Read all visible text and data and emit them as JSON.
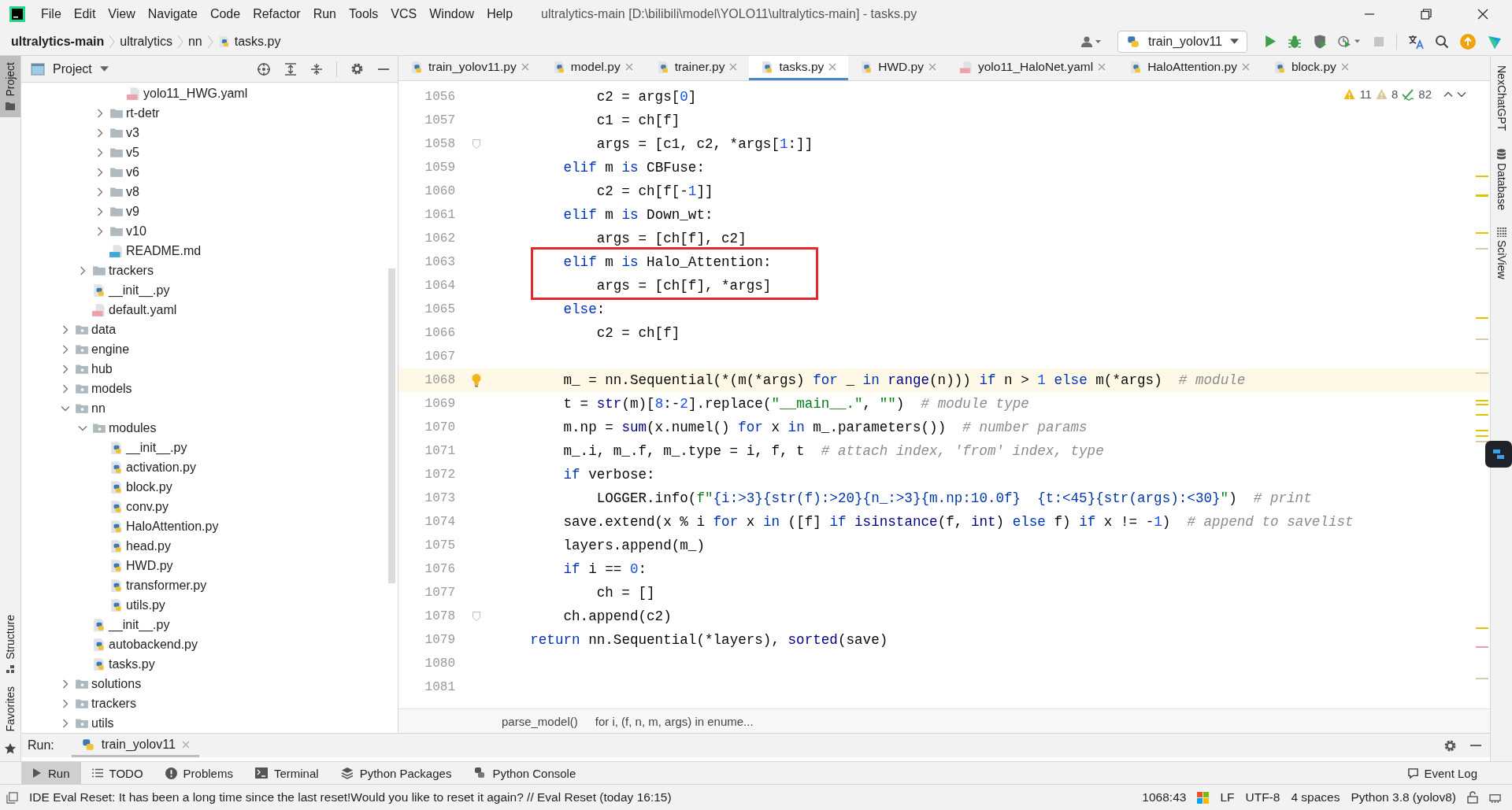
{
  "window": {
    "title": "ultralytics-main [D:\\bilibili\\model\\YOLO11\\ultralytics-main] - tasks.py",
    "menu": [
      "File",
      "Edit",
      "View",
      "Navigate",
      "Code",
      "Refactor",
      "Run",
      "Tools",
      "VCS",
      "Window",
      "Help"
    ]
  },
  "navbar": {
    "crumbs": [
      {
        "label": "ultralytics-main",
        "kind": "project"
      },
      {
        "label": "ultralytics",
        "kind": "folder"
      },
      {
        "label": "nn",
        "kind": "folder"
      },
      {
        "label": "tasks.py",
        "kind": "py"
      }
    ]
  },
  "toolbar": {
    "run_config": "train_yolov11"
  },
  "left_strip": [
    {
      "label": "Project",
      "kind": "project",
      "selected": true
    },
    {
      "label": "Structure",
      "kind": "structure",
      "selected": false
    },
    {
      "label": "Favorites",
      "kind": "favorites",
      "selected": false
    }
  ],
  "project": {
    "title": "Project",
    "tree": [
      {
        "children": [
          {
            "children": [
              {
                "children": [
                  {
                    "label": "yolo11_HWG.yaml",
                    "kind": "yaml"
                  }
                ]
              },
              {
                "label": "rt-detr",
                "kind": "folder",
                "expanded": false
              },
              {
                "label": "v3",
                "kind": "folder",
                "expanded": false
              },
              {
                "label": "v5",
                "kind": "folder",
                "expanded": false
              },
              {
                "label": "v6",
                "kind": "folder",
                "expanded": false
              },
              {
                "label": "v8",
                "kind": "folder",
                "expanded": false
              },
              {
                "label": "v9",
                "kind": "folder",
                "expanded": false
              },
              {
                "label": "v10",
                "kind": "folder",
                "expanded": false
              },
              {
                "label": "README.md",
                "kind": "md"
              }
            ]
          },
          {
            "label": "trackers",
            "kind": "folder",
            "expanded": false
          },
          {
            "label": "__init__.py",
            "kind": "py"
          },
          {
            "label": "default.yaml",
            "kind": "yaml"
          }
        ]
      },
      {
        "label": "data",
        "kind": "package",
        "expanded": false
      },
      {
        "label": "engine",
        "kind": "package",
        "expanded": false
      },
      {
        "label": "hub",
        "kind": "package",
        "expanded": false
      },
      {
        "label": "models",
        "kind": "package",
        "expanded": false
      },
      {
        "label": "nn",
        "kind": "package",
        "expanded": true,
        "children": [
          {
            "label": "modules",
            "kind": "package",
            "expanded": true,
            "children": [
              {
                "label": "__init__.py",
                "kind": "py"
              },
              {
                "label": "activation.py",
                "kind": "py"
              },
              {
                "label": "block.py",
                "kind": "py"
              },
              {
                "label": "conv.py",
                "kind": "py"
              },
              {
                "label": "HaloAttention.py",
                "kind": "py"
              },
              {
                "label": "head.py",
                "kind": "py"
              },
              {
                "label": "HWD.py",
                "kind": "py"
              },
              {
                "label": "transformer.py",
                "kind": "py"
              },
              {
                "label": "utils.py",
                "kind": "py"
              }
            ]
          },
          {
            "label": "__init__.py",
            "kind": "py"
          },
          {
            "label": "autobackend.py",
            "kind": "py"
          },
          {
            "label": "tasks.py",
            "kind": "py"
          }
        ]
      },
      {
        "label": "solutions",
        "kind": "package",
        "expanded": false
      },
      {
        "label": "trackers",
        "kind": "package",
        "expanded": false
      },
      {
        "label": "utils",
        "kind": "package",
        "expanded": false
      }
    ]
  },
  "tabs": [
    {
      "label": "train_yolov11.py",
      "kind": "py",
      "selected": false
    },
    {
      "label": "model.py",
      "kind": "py",
      "selected": false
    },
    {
      "label": "trainer.py",
      "kind": "py",
      "selected": false
    },
    {
      "label": "tasks.py",
      "kind": "py",
      "selected": true
    },
    {
      "label": "HWD.py",
      "kind": "py",
      "selected": false
    },
    {
      "label": "yolo11_HaloNet.yaml",
      "kind": "yaml",
      "selected": false
    },
    {
      "label": "HaloAttention.py",
      "kind": "py",
      "selected": false
    },
    {
      "label": "block.py",
      "kind": "py",
      "selected": false
    }
  ],
  "inspections": {
    "warnings": "11",
    "weak_warnings": "8",
    "typos": "82"
  },
  "code": {
    "lines": [
      {
        "number": "1056",
        "current": false,
        "boxed": false,
        "segments": [
          {
            "text": "            c2 = args[",
            "kind": "p"
          },
          {
            "text": "0",
            "kind": "num"
          },
          {
            "text": "]",
            "kind": "p"
          }
        ]
      },
      {
        "number": "1057",
        "current": false,
        "boxed": false,
        "segments": [
          {
            "text": "            c1 = ch[f]",
            "kind": "p"
          }
        ]
      },
      {
        "number": "1058",
        "current": false,
        "boxed": false,
        "kind": "fold",
        "segments": [
          {
            "text": "            args = [c1, c2, *args[",
            "kind": "p"
          },
          {
            "text": "1",
            "kind": "num"
          },
          {
            "text": ":]]",
            "kind": "p"
          }
        ]
      },
      {
        "number": "1059",
        "current": false,
        "boxed": false,
        "segments": [
          {
            "text": "        elif",
            "kind": "kw"
          },
          {
            "text": " m ",
            "kind": "p"
          },
          {
            "text": "is",
            "kind": "kw"
          },
          {
            "text": " CBFuse:",
            "kind": "p"
          }
        ]
      },
      {
        "number": "1060",
        "current": false,
        "boxed": false,
        "segments": [
          {
            "text": "            c2 = ch[f[-",
            "kind": "p"
          },
          {
            "text": "1",
            "kind": "num"
          },
          {
            "text": "]]",
            "kind": "p"
          }
        ]
      },
      {
        "number": "1061",
        "current": false,
        "boxed": false,
        "segments": [
          {
            "text": "        elif",
            "kind": "kw"
          },
          {
            "text": " m ",
            "kind": "p"
          },
          {
            "text": "is",
            "kind": "kw"
          },
          {
            "text": " Down_wt:",
            "kind": "p"
          }
        ]
      },
      {
        "number": "1062",
        "current": false,
        "boxed": false,
        "segments": [
          {
            "text": "            args = [ch[f], c2]",
            "kind": "p"
          }
        ]
      },
      {
        "number": "1063",
        "current": false,
        "boxed": true,
        "segments": [
          {
            "text": "        elif",
            "kind": "kw"
          },
          {
            "text": " m ",
            "kind": "p"
          },
          {
            "text": "is",
            "kind": "kw"
          },
          {
            "text": " Halo_Attention:",
            "kind": "p"
          }
        ]
      },
      {
        "number": "1064",
        "current": false,
        "boxed": true,
        "segments": [
          {
            "text": "            args = [ch[f], *args]",
            "kind": "p"
          }
        ]
      },
      {
        "number": "1065",
        "current": false,
        "boxed": false,
        "segments": [
          {
            "text": "        else",
            "kind": "kw"
          },
          {
            "text": ":",
            "kind": "p"
          }
        ]
      },
      {
        "number": "1066",
        "current": false,
        "boxed": false,
        "segments": [
          {
            "text": "            c2 = ch[f]",
            "kind": "p"
          }
        ]
      },
      {
        "number": "1067",
        "current": false,
        "boxed": false
      },
      {
        "number": "1068",
        "current": true,
        "boxed": false,
        "kind": "bulb",
        "segments": [
          {
            "text": "        m_ = nn.Sequential(*(m(*args) ",
            "kind": "p"
          },
          {
            "text": "for",
            "kind": "kw"
          },
          {
            "text": " _ ",
            "kind": "p"
          },
          {
            "text": "in",
            "kind": "kw"
          },
          {
            "text": " range",
            "kind": "bi"
          },
          {
            "text": "(n))) ",
            "kind": "p"
          },
          {
            "text": "if",
            "kind": "kw"
          },
          {
            "text": " n > ",
            "kind": "p"
          },
          {
            "text": "1",
            "kind": "num"
          },
          {
            "text": " else",
            "kind": "kw"
          },
          {
            "text": " m(*args)  ",
            "kind": "p"
          },
          {
            "text": "# module",
            "kind": "com"
          }
        ]
      },
      {
        "number": "1069",
        "current": false,
        "boxed": false,
        "segments": [
          {
            "text": "        t = ",
            "kind": "p"
          },
          {
            "text": "str",
            "kind": "bi"
          },
          {
            "text": "(m)[",
            "kind": "p"
          },
          {
            "text": "8",
            "kind": "num"
          },
          {
            "text": ":-",
            "kind": "p"
          },
          {
            "text": "2",
            "kind": "num"
          },
          {
            "text": "].replace(",
            "kind": "p"
          },
          {
            "text": "\"__main__.\"",
            "kind": "str"
          },
          {
            "text": ", ",
            "kind": "p"
          },
          {
            "text": "\"\"",
            "kind": "str"
          },
          {
            "text": ")  ",
            "kind": "p"
          },
          {
            "text": "# module type",
            "kind": "com"
          }
        ]
      },
      {
        "number": "1070",
        "current": false,
        "boxed": false,
        "segments": [
          {
            "text": "        m.np = ",
            "kind": "p"
          },
          {
            "text": "sum",
            "kind": "bi"
          },
          {
            "text": "(x.numel() ",
            "kind": "p"
          },
          {
            "text": "for",
            "kind": "kw"
          },
          {
            "text": " x ",
            "kind": "p"
          },
          {
            "text": "in",
            "kind": "kw"
          },
          {
            "text": " m_.parameters())  ",
            "kind": "p"
          },
          {
            "text": "# number params",
            "kind": "com"
          }
        ]
      },
      {
        "number": "1071",
        "current": false,
        "boxed": false,
        "segments": [
          {
            "text": "        m_.i, m_.f, m_.type = i, f, t  ",
            "kind": "p"
          },
          {
            "text": "# attach index, 'from' index, type",
            "kind": "com"
          }
        ]
      },
      {
        "number": "1072",
        "current": false,
        "boxed": false,
        "segments": [
          {
            "text": "        if",
            "kind": "kw"
          },
          {
            "text": " verbose:",
            "kind": "p"
          }
        ]
      },
      {
        "number": "1073",
        "current": false,
        "boxed": false,
        "segments": [
          {
            "text": "            LOGGER.info(",
            "kind": "p"
          },
          {
            "text": "f\"",
            "kind": "str"
          },
          {
            "text": "{i:>3}{str(f):>20}{n_:>3}{m.np:10.0f}  {t:<45}{str(args):<30}",
            "kind": "fs"
          },
          {
            "text": "\"",
            "kind": "str"
          },
          {
            "text": ")  ",
            "kind": "p"
          },
          {
            "text": "# print",
            "kind": "com"
          }
        ]
      },
      {
        "number": "1074",
        "current": false,
        "boxed": false,
        "segments": [
          {
            "text": "        save.extend(x % i ",
            "kind": "p"
          },
          {
            "text": "for",
            "kind": "kw"
          },
          {
            "text": " x ",
            "kind": "p"
          },
          {
            "text": "in",
            "kind": "kw"
          },
          {
            "text": " ([f] ",
            "kind": "p"
          },
          {
            "text": "if",
            "kind": "kw"
          },
          {
            "text": " isinstance",
            "kind": "bi"
          },
          {
            "text": "(f, ",
            "kind": "p"
          },
          {
            "text": "int",
            "kind": "bi"
          },
          {
            "text": ") ",
            "kind": "p"
          },
          {
            "text": "else",
            "kind": "kw"
          },
          {
            "text": " f) ",
            "kind": "p"
          },
          {
            "text": "if",
            "kind": "kw"
          },
          {
            "text": " x != -",
            "kind": "p"
          },
          {
            "text": "1",
            "kind": "num"
          },
          {
            "text": ")  ",
            "kind": "p"
          },
          {
            "text": "# append to savelist",
            "kind": "com"
          }
        ]
      },
      {
        "number": "1075",
        "current": false,
        "boxed": false,
        "segments": [
          {
            "text": "        layers.append(m_)",
            "kind": "p"
          }
        ]
      },
      {
        "number": "1076",
        "current": false,
        "boxed": false,
        "segments": [
          {
            "text": "        if",
            "kind": "kw"
          },
          {
            "text": " i == ",
            "kind": "p"
          },
          {
            "text": "0",
            "kind": "num"
          },
          {
            "text": ":",
            "kind": "p"
          }
        ]
      },
      {
        "number": "1077",
        "current": false,
        "boxed": false,
        "segments": [
          {
            "text": "            ch = []",
            "kind": "p"
          }
        ]
      },
      {
        "number": "1078",
        "current": false,
        "boxed": false,
        "kind": "fold",
        "segments": [
          {
            "text": "        ch.append(c2)",
            "kind": "p"
          }
        ]
      },
      {
        "number": "1079",
        "current": false,
        "boxed": false,
        "segments": [
          {
            "text": "    return",
            "kind": "kw"
          },
          {
            "text": " nn.Sequential(*layers), ",
            "kind": "p"
          },
          {
            "text": "sorted",
            "kind": "bi"
          },
          {
            "text": "(save)",
            "kind": "p"
          }
        ]
      },
      {
        "number": "1080",
        "current": false,
        "boxed": false
      },
      {
        "number": "1081",
        "current": false,
        "boxed": false
      }
    ]
  },
  "breadcrumbs": [
    "parse_model()",
    "for i, (f, n, m, args) in enume..."
  ],
  "right_strip": [
    {
      "label": "NexChatGPT",
      "kind": "plain"
    },
    {
      "label": "Database",
      "kind": "database"
    },
    {
      "label": "SciView",
      "kind": "grid"
    }
  ],
  "run_panel": {
    "label": "Run:",
    "tabs": [
      {
        "label": "train_yolov11",
        "selected": true
      }
    ]
  },
  "tool_windows": [
    {
      "label": "Run",
      "kind": "run",
      "selected": true
    },
    {
      "label": "TODO",
      "kind": "list",
      "selected": false
    },
    {
      "label": "Problems",
      "kind": "problems",
      "selected": false
    },
    {
      "label": "Terminal",
      "kind": "terminal",
      "selected": false
    },
    {
      "label": "Python Packages",
      "kind": "layers",
      "selected": false
    },
    {
      "label": "Python Console",
      "kind": "python",
      "selected": false
    }
  ],
  "event_log": "Event Log",
  "status": {
    "message": "IDE Eval Reset: It has been a long time since the last reset!Would you like to reset it again? // Eval Reset (today 16:15)",
    "position": "1068:43",
    "line_separator": "LF",
    "encoding": "UTF-8",
    "indent": "4 spaces",
    "interpreter": "Python 3.8 (yolov8)"
  }
}
